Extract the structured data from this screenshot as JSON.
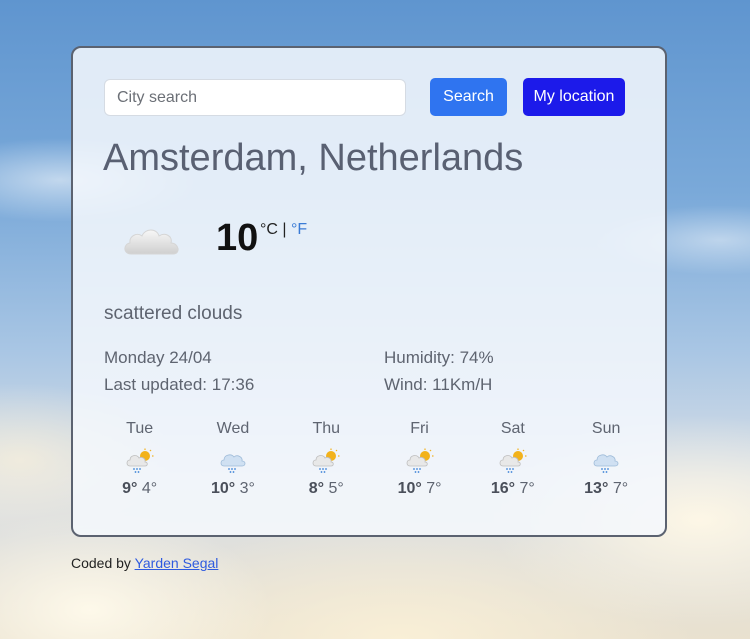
{
  "search": {
    "placeholder": "City search",
    "button_label": "Search",
    "location_button_label": "My location"
  },
  "current": {
    "city": "Amsterdam, Netherlands",
    "icon": "scattered-clouds-icon",
    "temperature": "10",
    "unit_c": "°C",
    "separator": "|",
    "unit_f": "°F",
    "description": "scattered clouds",
    "date": "Monday 24/04",
    "last_updated": "Last updated: 17:36",
    "humidity": "Humidity: 74%",
    "wind": "Wind: 11Km/H"
  },
  "forecast": [
    {
      "day": "Tue",
      "icon": "sun-cloud-rain-icon",
      "max": "9°",
      "min": "4°"
    },
    {
      "day": "Wed",
      "icon": "cloud-rain-icon",
      "max": "10°",
      "min": "3°"
    },
    {
      "day": "Thu",
      "icon": "sun-cloud-rain-icon",
      "max": "8°",
      "min": "5°"
    },
    {
      "day": "Fri",
      "icon": "sun-cloud-rain-icon",
      "max": "10°",
      "min": "7°"
    },
    {
      "day": "Sat",
      "icon": "sun-cloud-rain-icon",
      "max": "16°",
      "min": "7°"
    },
    {
      "day": "Sun",
      "icon": "cloud-rain-icon",
      "max": "13°",
      "min": "7°"
    }
  ],
  "footer": {
    "prefix": "Coded by",
    "author": "Yarden Segal"
  },
  "colors": {
    "search_button": "#2f74f0",
    "location_button": "#1c1aea",
    "link": "#3a7bd5"
  }
}
